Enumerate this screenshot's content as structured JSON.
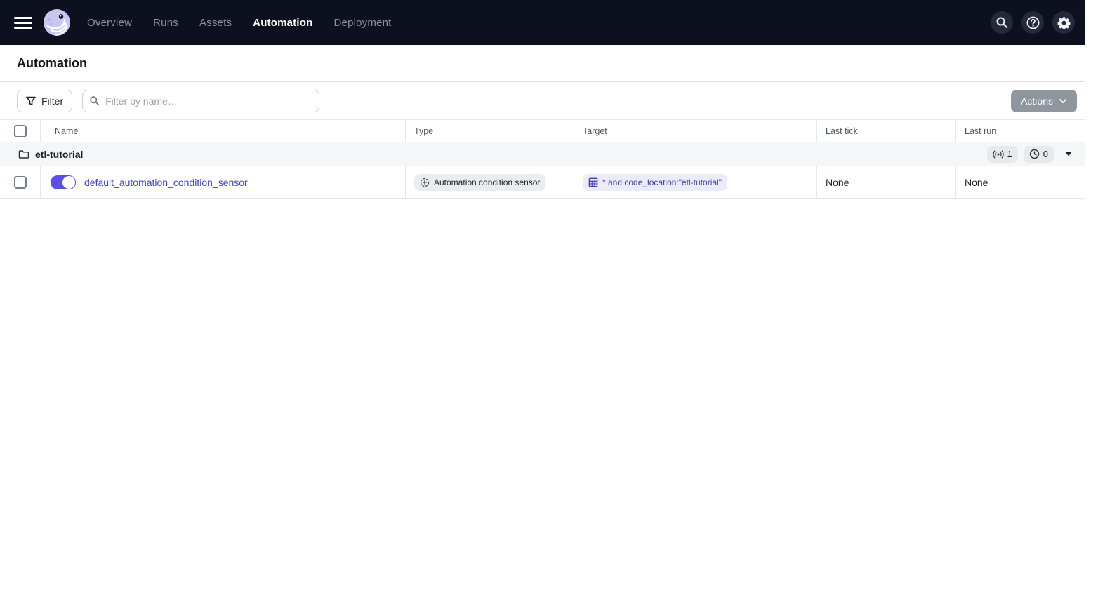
{
  "nav": {
    "items": [
      {
        "label": "Overview",
        "active": false
      },
      {
        "label": "Runs",
        "active": false
      },
      {
        "label": "Assets",
        "active": false
      },
      {
        "label": "Automation",
        "active": true
      },
      {
        "label": "Deployment",
        "active": false
      }
    ],
    "icons": {
      "menu": "hamburger",
      "logo": "dagster-octopus",
      "search": "magnifier",
      "help": "question-mark-circle",
      "settings": "gear"
    }
  },
  "page": {
    "title": "Automation"
  },
  "toolbar": {
    "filter_button": "Filter",
    "search_placeholder": "Filter by name…",
    "search_value": "",
    "actions_button": "Actions"
  },
  "table": {
    "columns": {
      "name": "Name",
      "type": "Type",
      "target": "Target",
      "last_tick": "Last tick",
      "last_run": "Last run"
    },
    "group": {
      "name": "etl-tutorial",
      "sensor_count": "1",
      "schedule_count": "0",
      "icons": {
        "group": "folder",
        "sensors": "sensor-waves",
        "schedules": "clock",
        "expand": "caret-down"
      }
    },
    "rows": [
      {
        "name": "default_automation_condition_sensor",
        "enabled": true,
        "type": "Automation condition sensor",
        "type_icon": "automation-condition-dashed-circle-plus",
        "target": "* and code_location:\"etl-tutorial\"",
        "target_icon": "asset-table-grid",
        "last_tick": "None",
        "last_run": "None"
      }
    ]
  },
  "colors": {
    "navbar_bg": "#0d101f",
    "accent_toggle": "#5c4fe5",
    "link": "#4242cc",
    "tag_target_bg": "#ececf9",
    "tag_target_text": "#3c3cae",
    "group_row_bg": "#f4f6f8",
    "actions_disabled_bg": "#8f969e",
    "border": "#e4e7eb"
  }
}
